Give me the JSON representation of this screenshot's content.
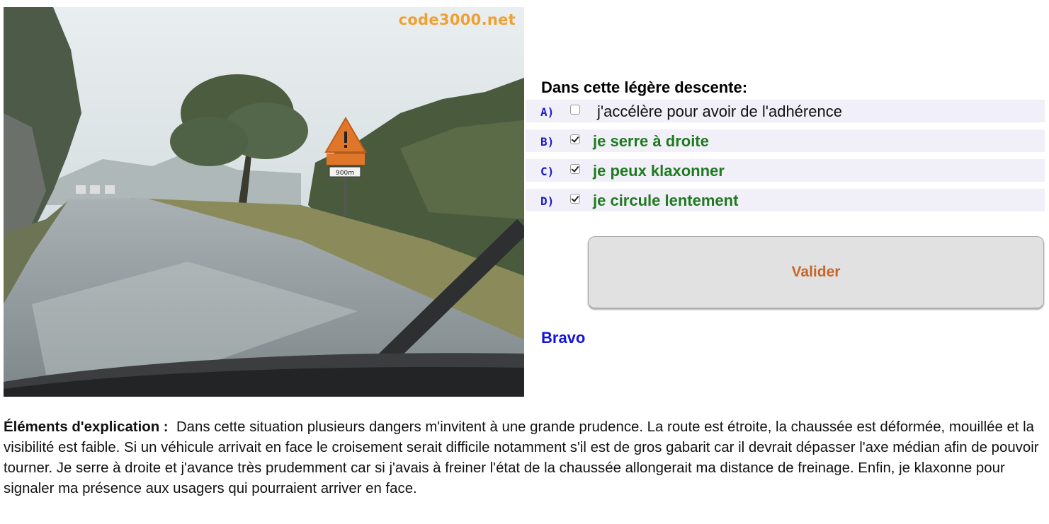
{
  "image": {
    "watermark": "code3000.net",
    "sign_distance": "900m"
  },
  "question": {
    "prompt": "Dans cette légère descente:"
  },
  "answers": [
    {
      "letter": "A)",
      "text": "j'accélère pour avoir de l'adhérence",
      "checked": false,
      "correct": false
    },
    {
      "letter": "B)",
      "text": "je serre à droite",
      "checked": true,
      "correct": true
    },
    {
      "letter": "C)",
      "text": "je peux klaxonner",
      "checked": true,
      "correct": true
    },
    {
      "letter": "D)",
      "text": "je circule lentement",
      "checked": true,
      "correct": true
    }
  ],
  "actions": {
    "validate_label": "Valider"
  },
  "result": {
    "message": "Bravo"
  },
  "explanation": {
    "label": "Éléments d'explication :",
    "text": "Dans cette situation plusieurs dangers m'invitent à une grande prudence. La route est étroite, la chaussée est déformée, mouillée et la visibilité est faible. Si un véhicule arrivait en face le croisement serait difficile notamment s'il est de gros gabarit car il devrait dépasser l'axe médian afin de pouvoir tourner. Je serre à droite et j'avance très prudemment car si j'avais à freiner l'état de la chaussée allongerait ma distance de freinage. Enfin, je klaxonne pour signaler ma présence aux usagers qui pourraient arriver en face."
  },
  "colors": {
    "question_letter": "#1a1acc",
    "correct_answer": "#1f7a1f",
    "validate_text": "#c8662a",
    "result_text": "#1414d8",
    "watermark": "#f0a030"
  }
}
